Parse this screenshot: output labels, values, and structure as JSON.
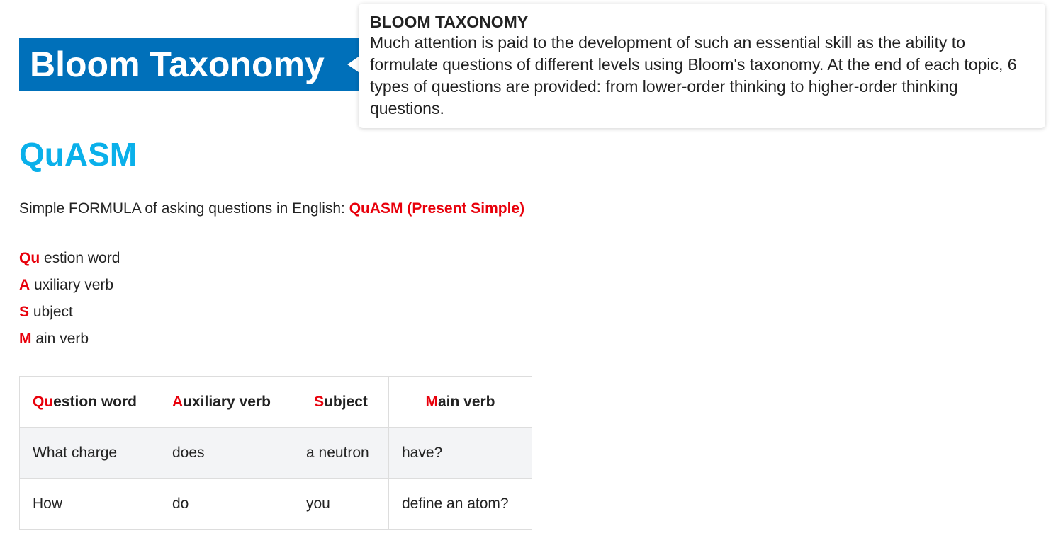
{
  "banner": {
    "title": "Bloom Taxonomy"
  },
  "tooltip": {
    "title": "BLOOM TAXONOMY",
    "body": "Much attention is paid to the development of such an essential skill as the ability to formulate questions of different levels using Bloom's taxonomy. At the end of each topic, 6 types of questions are provided: from lower-order thinking to higher-order thinking questions."
  },
  "main": {
    "heading": "QuASM",
    "formula_prefix": "Simple FORMULA of asking questions in English: ",
    "formula_highlight": "QuASM (Present Simple)",
    "acronym": [
      {
        "letter": "Qu",
        "rest": " estion word"
      },
      {
        "letter": "A",
        "rest": " uxiliary verb"
      },
      {
        "letter": "S",
        "rest": " ubject"
      },
      {
        "letter": "M",
        "rest": " ain verb"
      }
    ]
  },
  "table": {
    "headers": [
      {
        "highlight": "Qu",
        "rest": "estion word"
      },
      {
        "highlight": "A",
        "rest": "uxiliary verb"
      },
      {
        "highlight": "S",
        "rest": "ubject"
      },
      {
        "highlight": "M",
        "rest": "ain verb"
      }
    ],
    "rows": [
      [
        "What charge",
        "does",
        "a neutron",
        "have?"
      ],
      [
        "How",
        "do",
        "you",
        "define an atom?"
      ]
    ]
  },
  "colors": {
    "banner_bg": "#0070ba",
    "heading": "#0ab0ea",
    "accent_red": "#e8000b",
    "row_alt": "#f3f4f6"
  }
}
